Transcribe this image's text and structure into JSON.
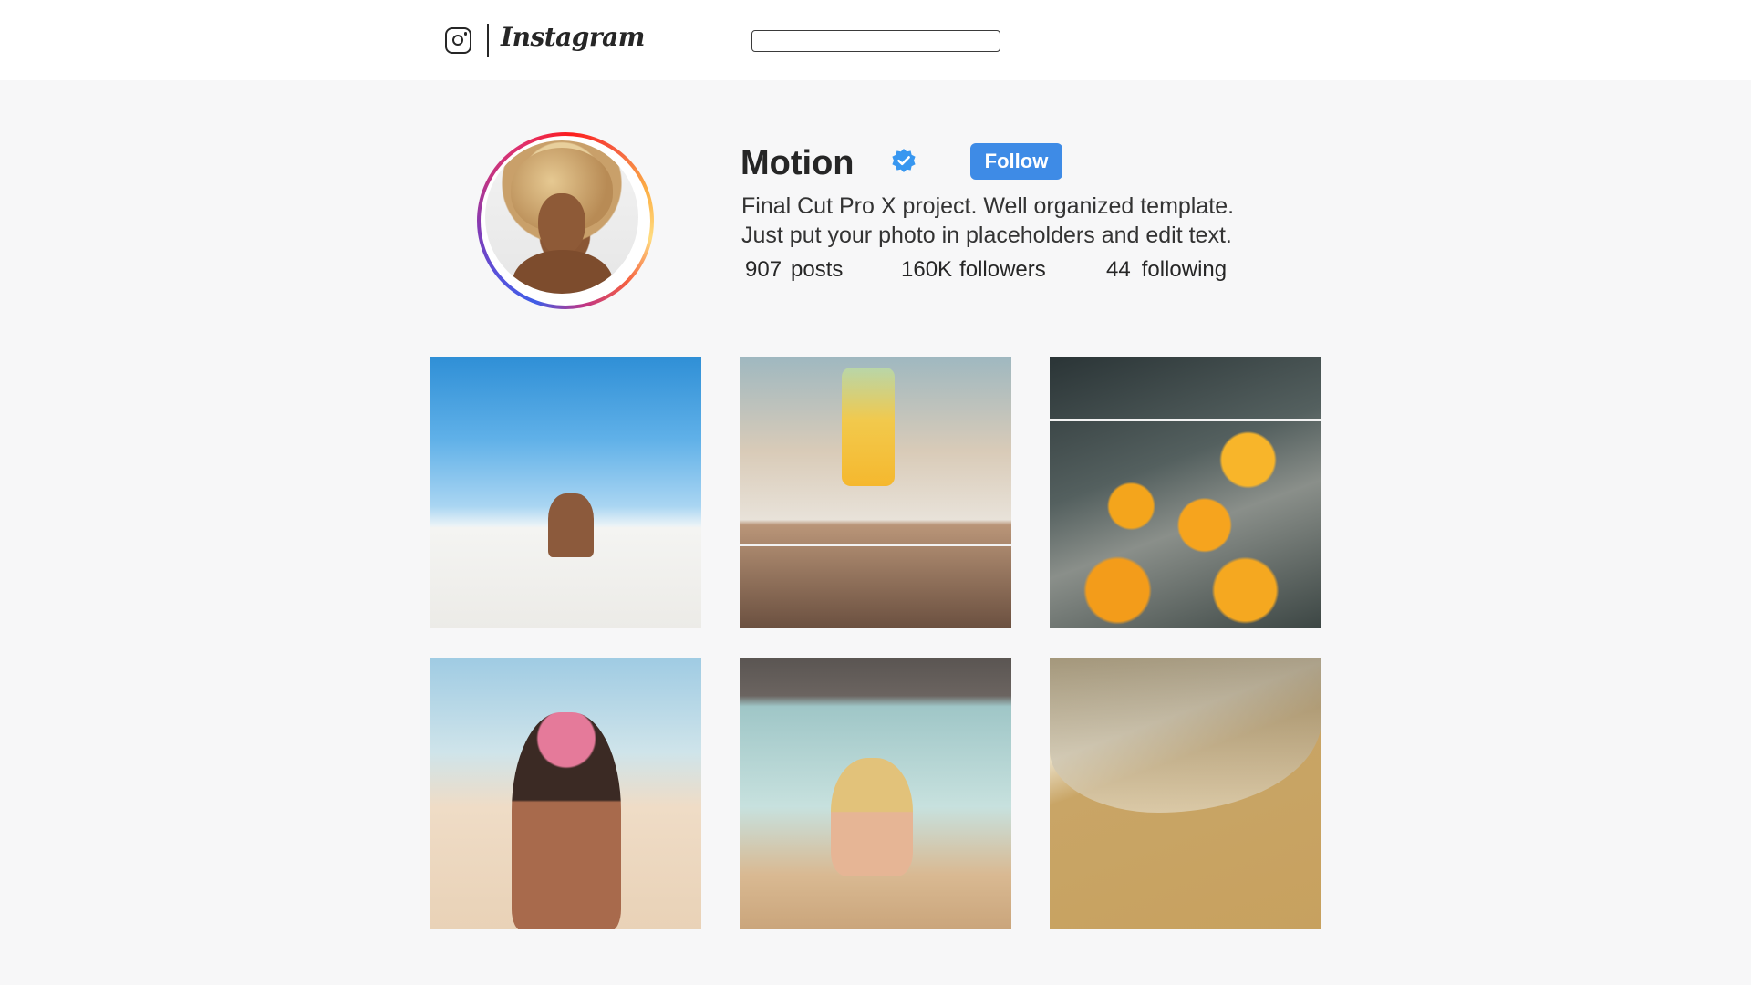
{
  "header": {
    "brand": "Instagram",
    "search": {
      "value": "",
      "placeholder": ""
    }
  },
  "profile": {
    "username": "Motion",
    "verified": true,
    "follow_label": "Follow",
    "bio": [
      "Final Cut Pro X project. Well organized template.",
      "Just put your photo in placeholders and edit text."
    ],
    "stats": {
      "posts": {
        "value": "907",
        "label": "posts"
      },
      "followers": {
        "value": "160K",
        "label": "followers"
      },
      "following": {
        "value": "44",
        "label": "following"
      }
    }
  },
  "colors": {
    "follow_button": "#3e8be6",
    "verified_badge": "#3897f0",
    "page_background": "#f7f7f8",
    "header_background": "#ffffff"
  },
  "icons": [
    "instagram-glyph-icon",
    "verified-badge-icon"
  ],
  "posts": [
    {
      "id": "post-1",
      "subject": "beach-couple"
    },
    {
      "id": "post-2",
      "subject": "juice-drink"
    },
    {
      "id": "post-3",
      "subject": "orange-slices-water"
    },
    {
      "id": "post-4",
      "subject": "flower-crown"
    },
    {
      "id": "post-5",
      "subject": "mermaid-tail"
    },
    {
      "id": "post-6",
      "subject": "sand-writing"
    }
  ]
}
